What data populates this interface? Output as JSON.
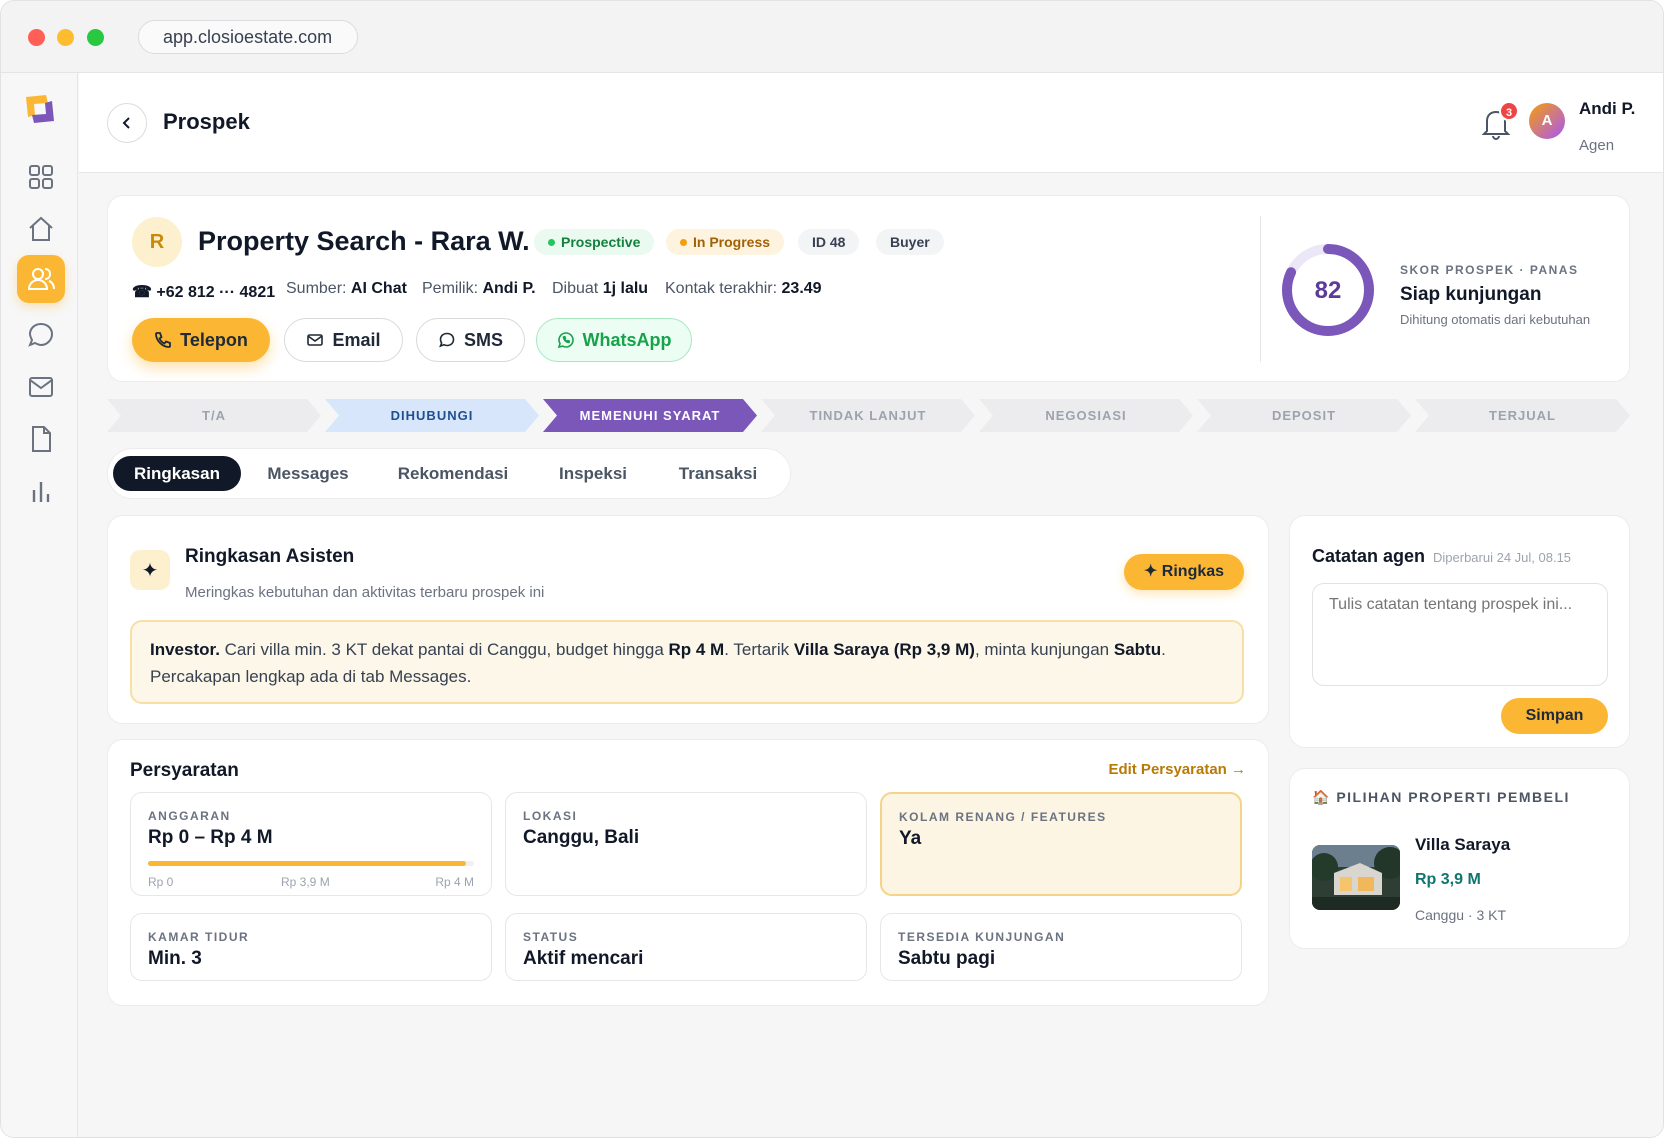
{
  "browser": {
    "url": "app.closioestate.com"
  },
  "header": {
    "title": "Prospek",
    "notifications_count": "3",
    "user": {
      "initial": "A",
      "name": "Andi P.",
      "role": "Agen"
    }
  },
  "sidebar": {
    "items": [
      {
        "icon": "grid-icon"
      },
      {
        "icon": "home-icon"
      },
      {
        "icon": "users-icon",
        "active": true
      },
      {
        "icon": "chat-icon"
      },
      {
        "icon": "mail-icon"
      },
      {
        "icon": "document-icon"
      },
      {
        "icon": "bar-chart-icon"
      }
    ]
  },
  "lead": {
    "initial": "R",
    "title": "Property Search - Rara W.",
    "badges": {
      "status": "Prospective",
      "progress": "In Progress",
      "id": "ID 48",
      "role": "Buyer"
    },
    "phone": "☎ +62 812 ··· 4821",
    "source_label": "Sumber:",
    "source": "AI Chat",
    "owner_label": "Pemilik:",
    "owner": "Andi P.",
    "created_label": "Dibuat",
    "created": "1j lalu",
    "last_contact_label": "Kontak terakhir:",
    "last_contact": "23.49",
    "actions": {
      "phone": "Telepon",
      "email": "Email",
      "sms": "SMS",
      "whatsapp": "WhatsApp"
    }
  },
  "score": {
    "value": "82",
    "fraction": 0.82,
    "label": "SKOR PROSPEK · PANAS",
    "headline": "Siap kunjungan",
    "sub": "Dihitung otomatis dari kebutuhan"
  },
  "pipeline": {
    "stages": [
      "T/A",
      "DIHUBUNGI",
      "MEMENUHI SYARAT",
      "TINDAK LANJUT",
      "NEGOSIASI",
      "DEPOSIT",
      "TERJUAL"
    ],
    "current": "MEMENUHI SYARAT"
  },
  "tabs": [
    "Ringkasan",
    "Messages",
    "Rekomendasi",
    "Inspeksi",
    "Transaksi"
  ],
  "summary": {
    "icon": "sparkle-icon",
    "title": "Ringkasan Asisten",
    "subtitle": "Meringkas kebutuhan dan aktivitas terbaru prospek ini",
    "button": "✦ Ringkas",
    "text": {
      "p1": "Investor.",
      "p2": " Cari villa min. 3 KT dekat pantai di Canggu, budget hingga ",
      "p3": "Rp 4 M",
      "p4": ". Tertarik ",
      "p5": "Villa Saraya (Rp 3,9 M)",
      "p6": ", minta kunjungan ",
      "p7": "Sabtu",
      "p8": ".",
      "p9": "Percakapan lengkap ada di tab Messages."
    }
  },
  "requirements": {
    "title": "Persyaratan",
    "edit": "Edit Persyaratan →",
    "budget": {
      "label": "ANGGARAN",
      "value": "Rp 0 – Rp 4 M",
      "fill": 0.975,
      "min": "Rp 0",
      "mid": "Rp 3,9 M",
      "max": "Rp 4 M"
    },
    "location": {
      "label": "LOKASI",
      "value": "Canggu, Bali"
    },
    "features": {
      "label": "KOLAM RENANG / FEATURES",
      "value": "Ya"
    },
    "bedrooms": {
      "label": "KAMAR TIDUR",
      "value": "Min. 3"
    },
    "status": {
      "label": "STATUS",
      "value": "Aktif mencari"
    },
    "visit": {
      "label": "TERSEDIA KUNJUNGAN",
      "value": "Sabtu pagi"
    }
  },
  "notes": {
    "title": "Catatan agen",
    "updated": "Diperbarui 24 Jul, 08.15",
    "placeholder": "Tulis catatan tentang prospek ini...",
    "save": "Simpan"
  },
  "properties": {
    "title": "🏠 PILIHAN PROPERTI PEMBELI",
    "items": [
      {
        "name": "Villa Saraya",
        "price": "Rp 3,9 M",
        "meta": "Canggu · 3 KT"
      }
    ]
  },
  "colors": {
    "accent": "#fbb733",
    "stage_current": "#7b57b9",
    "stage_done": "#d7e6fb",
    "price": "#0f766e"
  }
}
